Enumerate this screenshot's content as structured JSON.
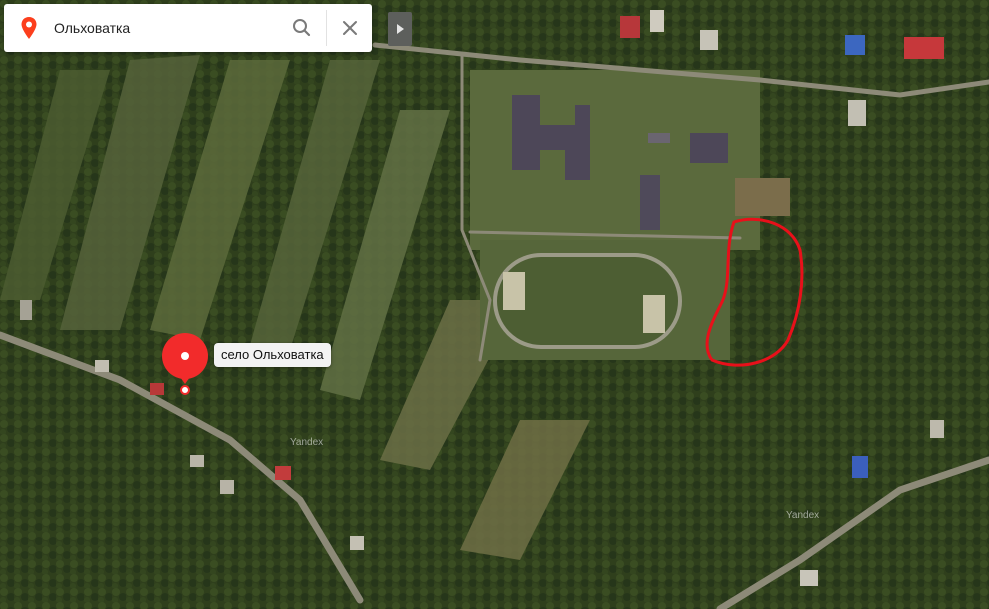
{
  "search": {
    "value": "Ольховатка",
    "logo_icon": "map-pin-logo-icon",
    "search_icon": "search-icon",
    "clear_icon": "close-icon"
  },
  "panel": {
    "toggle_icon": "chevron-right-icon"
  },
  "marker": {
    "label": "село Ольховатка",
    "color": "#f22b2b"
  },
  "attribution": {
    "provider_left": "Yandex",
    "provider_right": "Yandex"
  },
  "annotation": {
    "outline_color": "#e8101a"
  },
  "colors": {
    "satellite_base": "#3b4a22",
    "searchbar_bg": "#ffffff",
    "toggle_bg": "#5d5f5c"
  }
}
